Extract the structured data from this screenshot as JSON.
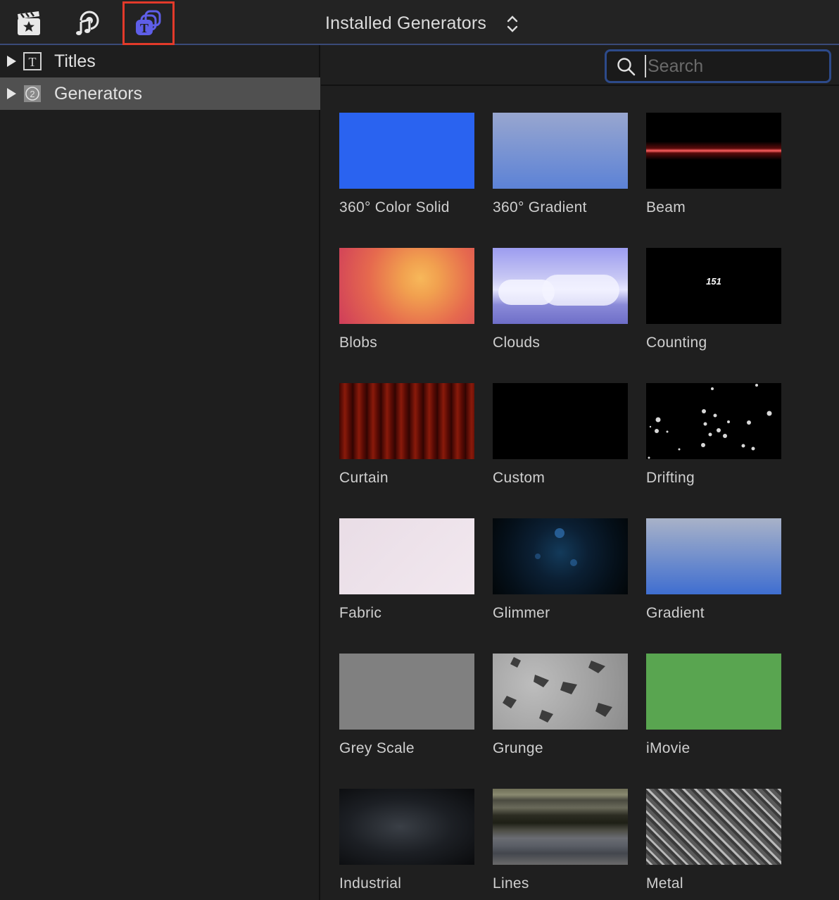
{
  "toolbar": {
    "title": "Installed Generators",
    "icons": [
      "clapper-star-icon",
      "photos-music-icon",
      "titles-generators-icon"
    ],
    "selected_color": "#e23a2a"
  },
  "sidebar": {
    "items": [
      {
        "label": "Titles",
        "icon": "title-t-icon"
      },
      {
        "label": "Generators",
        "icon": "generator-icon",
        "selected": true
      }
    ]
  },
  "search": {
    "placeholder": "Search",
    "value": ""
  },
  "generators": [
    {
      "label": "360° Color Solid"
    },
    {
      "label": "360° Gradient"
    },
    {
      "label": "Beam"
    },
    {
      "label": "Blobs"
    },
    {
      "label": "Clouds"
    },
    {
      "label": "Counting",
      "thumb_text": "151"
    },
    {
      "label": "Curtain"
    },
    {
      "label": "Custom"
    },
    {
      "label": "Drifting"
    },
    {
      "label": "Fabric"
    },
    {
      "label": "Glimmer"
    },
    {
      "label": "Gradient"
    },
    {
      "label": "Grey Scale"
    },
    {
      "label": "Grunge"
    },
    {
      "label": "iMovie"
    },
    {
      "label": "Industrial"
    },
    {
      "label": "Lines"
    },
    {
      "label": "Metal"
    }
  ]
}
